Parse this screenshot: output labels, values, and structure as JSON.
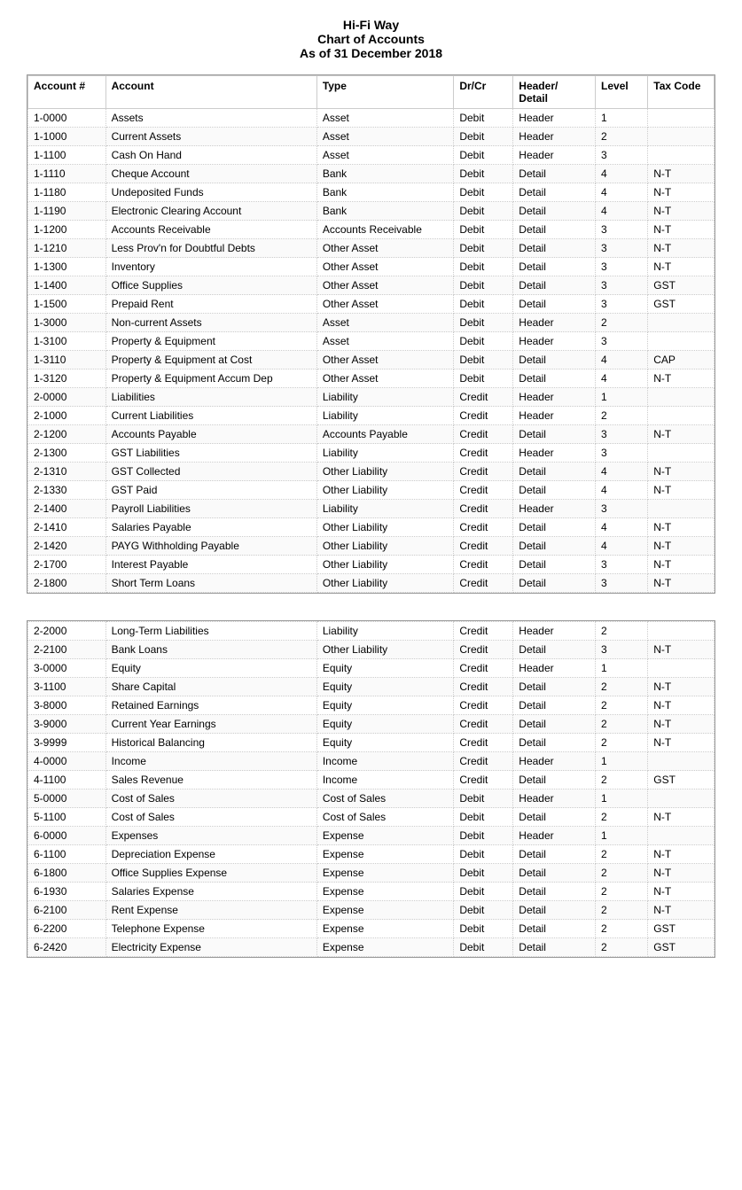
{
  "title": {
    "line1": "Hi-Fi Way",
    "line2": "Chart of Accounts",
    "line3": "As of 31 December 2018"
  },
  "columns": {
    "acct_num": "Account #",
    "account": "Account",
    "type": "Type",
    "drcr": "Dr/Cr",
    "header_detail": "Header/ Detail",
    "level": "Level",
    "tax_code": "Tax Code"
  },
  "rows": [
    {
      "num": "1-0000",
      "account": "Assets",
      "type": "Asset",
      "drcr": "Debit",
      "hd": "Header",
      "level": "1",
      "tax": ""
    },
    {
      "num": "1-1000",
      "account": "Current Assets",
      "type": "Asset",
      "drcr": "Debit",
      "hd": "Header",
      "level": "2",
      "tax": ""
    },
    {
      "num": "1-1100",
      "account": "Cash On Hand",
      "type": "Asset",
      "drcr": "Debit",
      "hd": "Header",
      "level": "3",
      "tax": ""
    },
    {
      "num": "1-1110",
      "account": "Cheque Account",
      "type": "Bank",
      "drcr": "Debit",
      "hd": "Detail",
      "level": "4",
      "tax": "N-T"
    },
    {
      "num": "1-1180",
      "account": "Undeposited Funds",
      "type": "Bank",
      "drcr": "Debit",
      "hd": "Detail",
      "level": "4",
      "tax": "N-T"
    },
    {
      "num": "1-1190",
      "account": "Electronic Clearing Account",
      "type": "Bank",
      "drcr": "Debit",
      "hd": "Detail",
      "level": "4",
      "tax": "N-T"
    },
    {
      "num": "1-1200",
      "account": "Accounts Receivable",
      "type": "Accounts Receivable",
      "drcr": "Debit",
      "hd": "Detail",
      "level": "3",
      "tax": "N-T"
    },
    {
      "num": "1-1210",
      "account": "Less Prov'n for Doubtful Debts",
      "type": "Other Asset",
      "drcr": "Debit",
      "hd": "Detail",
      "level": "3",
      "tax": "N-T"
    },
    {
      "num": "1-1300",
      "account": "Inventory",
      "type": "Other Asset",
      "drcr": "Debit",
      "hd": "Detail",
      "level": "3",
      "tax": "N-T"
    },
    {
      "num": "1-1400",
      "account": "Office Supplies",
      "type": "Other Asset",
      "drcr": "Debit",
      "hd": "Detail",
      "level": "3",
      "tax": "GST"
    },
    {
      "num": "1-1500",
      "account": "Prepaid Rent",
      "type": "Other Asset",
      "drcr": "Debit",
      "hd": "Detail",
      "level": "3",
      "tax": "GST"
    },
    {
      "num": "1-3000",
      "account": "Non-current Assets",
      "type": "Asset",
      "drcr": "Debit",
      "hd": "Header",
      "level": "2",
      "tax": ""
    },
    {
      "num": "1-3100",
      "account": "Property & Equipment",
      "type": "Asset",
      "drcr": "Debit",
      "hd": "Header",
      "level": "3",
      "tax": ""
    },
    {
      "num": "1-3110",
      "account": "Property & Equipment at Cost",
      "type": "Other Asset",
      "drcr": "Debit",
      "hd": "Detail",
      "level": "4",
      "tax": "CAP"
    },
    {
      "num": "1-3120",
      "account": "Property & Equipment Accum Dep",
      "type": "Other Asset",
      "drcr": "Debit",
      "hd": "Detail",
      "level": "4",
      "tax": "N-T"
    },
    {
      "num": "2-0000",
      "account": "Liabilities",
      "type": "Liability",
      "drcr": "Credit",
      "hd": "Header",
      "level": "1",
      "tax": ""
    },
    {
      "num": "2-1000",
      "account": "Current Liabilities",
      "type": "Liability",
      "drcr": "Credit",
      "hd": "Header",
      "level": "2",
      "tax": ""
    },
    {
      "num": "2-1200",
      "account": "Accounts Payable",
      "type": "Accounts Payable",
      "drcr": "Credit",
      "hd": "Detail",
      "level": "3",
      "tax": "N-T"
    },
    {
      "num": "2-1300",
      "account": "GST Liabilities",
      "type": "Liability",
      "drcr": "Credit",
      "hd": "Header",
      "level": "3",
      "tax": ""
    },
    {
      "num": "2-1310",
      "account": "GST Collected",
      "type": "Other Liability",
      "drcr": "Credit",
      "hd": "Detail",
      "level": "4",
      "tax": "N-T"
    },
    {
      "num": "2-1330",
      "account": "GST Paid",
      "type": "Other Liability",
      "drcr": "Credit",
      "hd": "Detail",
      "level": "4",
      "tax": "N-T"
    },
    {
      "num": "2-1400",
      "account": "Payroll Liabilities",
      "type": "Liability",
      "drcr": "Credit",
      "hd": "Header",
      "level": "3",
      "tax": ""
    },
    {
      "num": "2-1410",
      "account": "Salaries Payable",
      "type": "Other Liability",
      "drcr": "Credit",
      "hd": "Detail",
      "level": "4",
      "tax": "N-T"
    },
    {
      "num": "2-1420",
      "account": "PAYG Withholding Payable",
      "type": "Other Liability",
      "drcr": "Credit",
      "hd": "Detail",
      "level": "4",
      "tax": "N-T"
    },
    {
      "num": "2-1700",
      "account": "Interest Payable",
      "type": "Other Liability",
      "drcr": "Credit",
      "hd": "Detail",
      "level": "3",
      "tax": "N-T"
    },
    {
      "num": "2-1800",
      "account": "Short Term Loans",
      "type": "Other Liability",
      "drcr": "Credit",
      "hd": "Detail",
      "level": "3",
      "tax": "N-T"
    },
    {
      "num": "2-2000",
      "account": "Long-Term Liabilities",
      "type": "Liability",
      "drcr": "Credit",
      "hd": "Header",
      "level": "2",
      "tax": ""
    },
    {
      "num": "2-2100",
      "account": "Bank Loans",
      "type": "Other Liability",
      "drcr": "Credit",
      "hd": "Detail",
      "level": "3",
      "tax": "N-T"
    },
    {
      "num": "3-0000",
      "account": "Equity",
      "type": "Equity",
      "drcr": "Credit",
      "hd": "Header",
      "level": "1",
      "tax": ""
    },
    {
      "num": "3-1100",
      "account": "Share Capital",
      "type": "Equity",
      "drcr": "Credit",
      "hd": "Detail",
      "level": "2",
      "tax": "N-T"
    },
    {
      "num": "3-8000",
      "account": "Retained Earnings",
      "type": "Equity",
      "drcr": "Credit",
      "hd": "Detail",
      "level": "2",
      "tax": "N-T"
    },
    {
      "num": "3-9000",
      "account": "Current Year Earnings",
      "type": "Equity",
      "drcr": "Credit",
      "hd": "Detail",
      "level": "2",
      "tax": "N-T"
    },
    {
      "num": "3-9999",
      "account": "Historical Balancing",
      "type": "Equity",
      "drcr": "Credit",
      "hd": "Detail",
      "level": "2",
      "tax": "N-T"
    },
    {
      "num": "4-0000",
      "account": "Income",
      "type": "Income",
      "drcr": "Credit",
      "hd": "Header",
      "level": "1",
      "tax": ""
    },
    {
      "num": "4-1100",
      "account": "Sales Revenue",
      "type": "Income",
      "drcr": "Credit",
      "hd": "Detail",
      "level": "2",
      "tax": "GST"
    },
    {
      "num": "5-0000",
      "account": "Cost of Sales",
      "type": "Cost of Sales",
      "drcr": "Debit",
      "hd": "Header",
      "level": "1",
      "tax": ""
    },
    {
      "num": "5-1100",
      "account": "Cost of Sales",
      "type": "Cost of Sales",
      "drcr": "Debit",
      "hd": "Detail",
      "level": "2",
      "tax": "N-T"
    },
    {
      "num": "6-0000",
      "account": "Expenses",
      "type": "Expense",
      "drcr": "Debit",
      "hd": "Header",
      "level": "1",
      "tax": ""
    },
    {
      "num": "6-1100",
      "account": "Depreciation Expense",
      "type": "Expense",
      "drcr": "Debit",
      "hd": "Detail",
      "level": "2",
      "tax": "N-T"
    },
    {
      "num": "6-1800",
      "account": "Office Supplies Expense",
      "type": "Expense",
      "drcr": "Debit",
      "hd": "Detail",
      "level": "2",
      "tax": "N-T"
    },
    {
      "num": "6-1930",
      "account": "Salaries Expense",
      "type": "Expense",
      "drcr": "Debit",
      "hd": "Detail",
      "level": "2",
      "tax": "N-T"
    },
    {
      "num": "6-2100",
      "account": "Rent Expense",
      "type": "Expense",
      "drcr": "Debit",
      "hd": "Detail",
      "level": "2",
      "tax": "N-T"
    },
    {
      "num": "6-2200",
      "account": "Telephone Expense",
      "type": "Expense",
      "drcr": "Debit",
      "hd": "Detail",
      "level": "2",
      "tax": "GST"
    },
    {
      "num": "6-2420",
      "account": "Electricity Expense",
      "type": "Expense",
      "drcr": "Debit",
      "hd": "Detail",
      "level": "2",
      "tax": "GST"
    }
  ]
}
